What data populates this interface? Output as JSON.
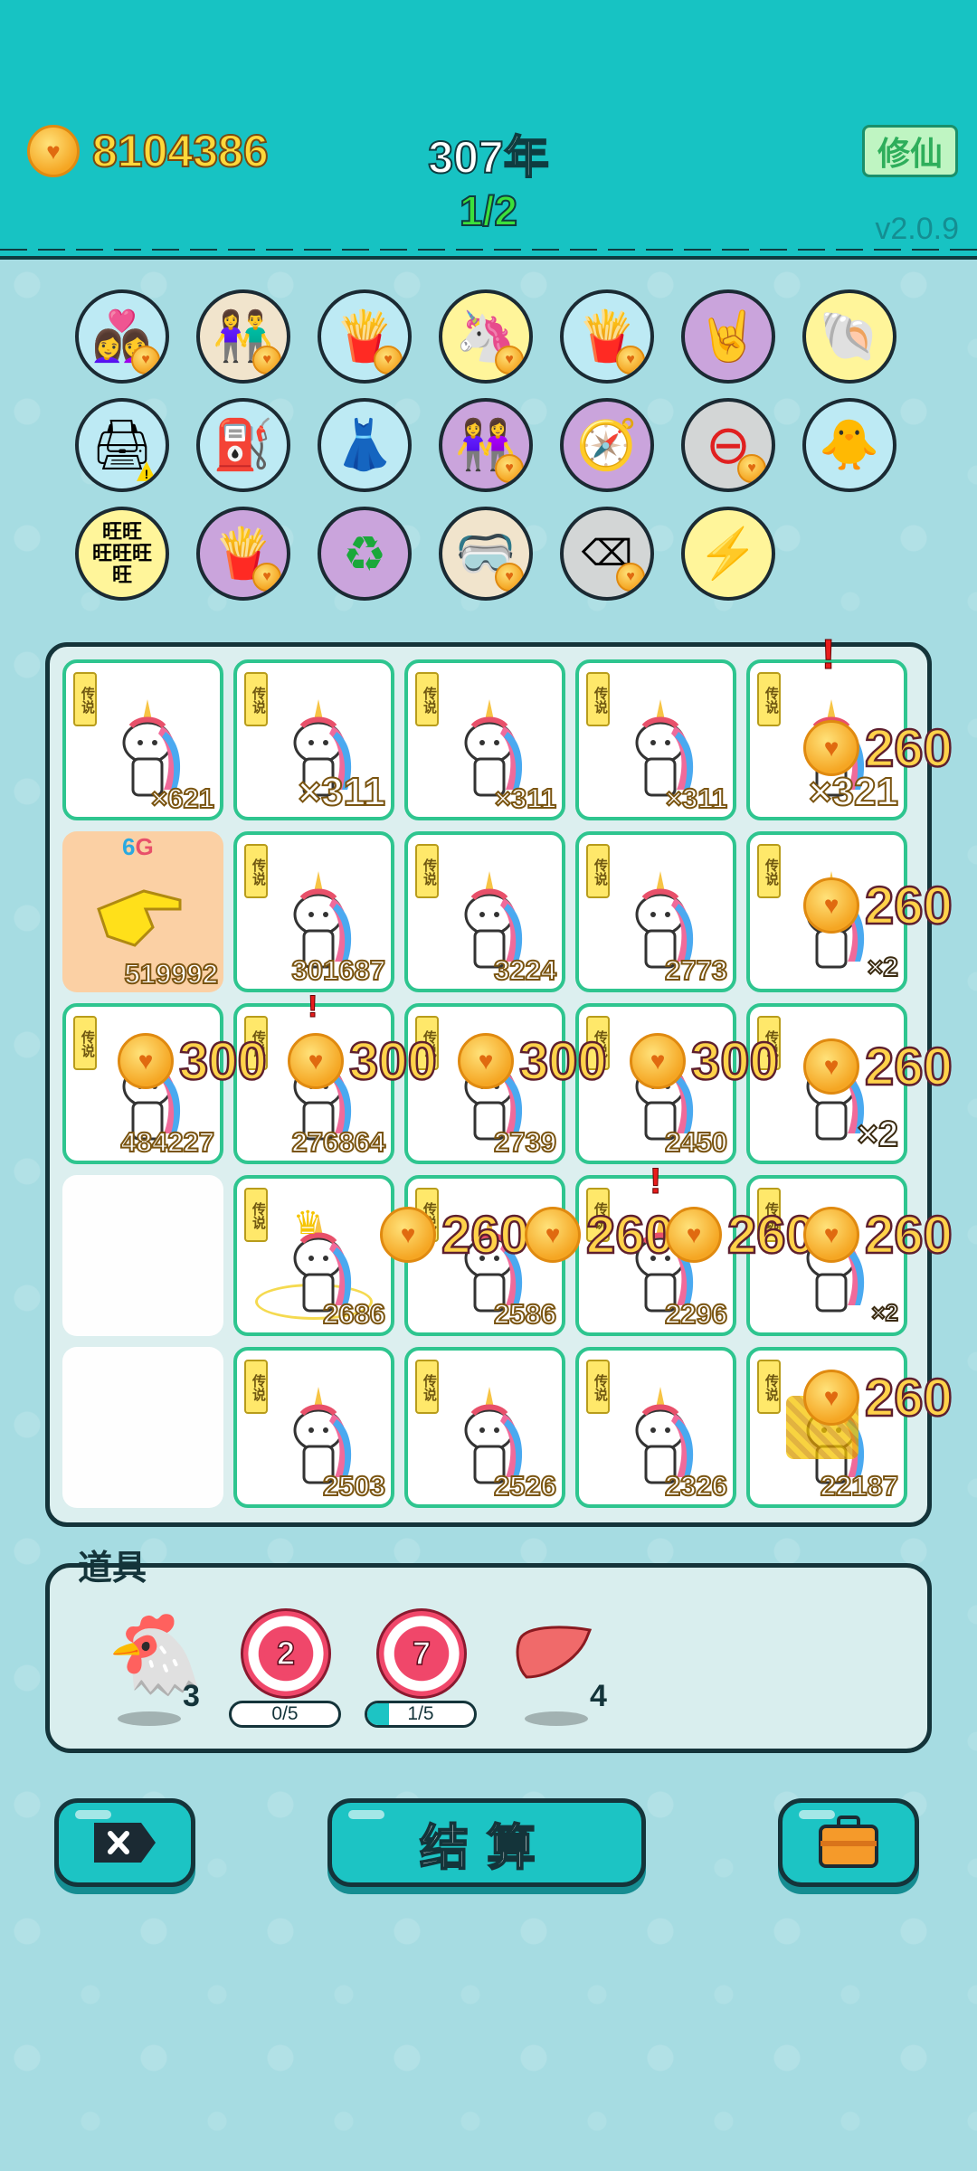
{
  "header": {
    "coins": "8104386",
    "year": "307年",
    "progress": "1/2",
    "xiuxian_label": "修仙",
    "version": "v2.0.9"
  },
  "skills": [
    {
      "name": "couple-icon",
      "color": "blue"
    },
    {
      "name": "couple-icon",
      "color": "cream"
    },
    {
      "name": "fries-icon",
      "color": "blue"
    },
    {
      "name": "unicorn-icon",
      "color": "yellow"
    },
    {
      "name": "fries-icon",
      "color": "blue"
    },
    {
      "name": "rock-hand-icon",
      "color": "purple"
    },
    {
      "name": "shell-icon",
      "color": "yellow"
    },
    {
      "name": "printer-icon",
      "color": "blue"
    },
    {
      "name": "pump-icon",
      "color": "blue"
    },
    {
      "name": "skirt-icon",
      "color": "blue"
    },
    {
      "name": "couple-icon",
      "color": "purple"
    },
    {
      "name": "compass-icon",
      "color": "purple"
    },
    {
      "name": "minus-icon",
      "color": "red"
    },
    {
      "name": "chick-egg-icon",
      "color": "blue"
    },
    {
      "name": "wang-text-icon",
      "color": "yellow"
    },
    {
      "name": "fries-icon",
      "color": "purple"
    },
    {
      "name": "recycle-icon",
      "color": "purple"
    },
    {
      "name": "goggles-icon",
      "color": "cream"
    },
    {
      "name": "delete-tag-icon",
      "color": "grey"
    },
    {
      "name": "lightning-icon",
      "color": "yellow"
    }
  ],
  "board": {
    "legend_tag": "传说",
    "pointer_label": "6G",
    "cells": [
      {
        "count": "×621"
      },
      {
        "count": "×311"
      },
      {
        "count": "×311"
      },
      {
        "count": "×311"
      },
      {
        "count": "×321"
      },
      {
        "count": "519992"
      },
      {
        "count": "301687"
      },
      {
        "count": "3224"
      },
      {
        "count": "2773"
      },
      {
        "count": "×2"
      },
      {
        "count": "484227"
      },
      {
        "count": "276864"
      },
      {
        "count": "2739"
      },
      {
        "count": "2450"
      },
      {
        "count": "×2"
      },
      {
        "count": ""
      },
      {
        "count": "2686"
      },
      {
        "count": "2586"
      },
      {
        "count": "2296"
      },
      {
        "count": "×2"
      },
      {
        "count": ""
      },
      {
        "count": "2503"
      },
      {
        "count": "2526"
      },
      {
        "count": "2326"
      },
      {
        "count": "22187"
      }
    ],
    "floats": [
      "260",
      "260",
      "300",
      "300",
      "300",
      "300",
      "260",
      "260",
      "260",
      "260",
      "260",
      "260",
      "300"
    ]
  },
  "props": {
    "title": "道具",
    "chicken_count": "3",
    "target1_value": "2",
    "target1_progress": "0/5",
    "target2_value": "7",
    "target2_progress": "1/5",
    "liver_count": "4"
  },
  "buttons": {
    "settle": "结算"
  },
  "colors": {
    "header": "#17c3c3",
    "cell_border": "#2ec58f",
    "accent": "#1cc4c4"
  }
}
